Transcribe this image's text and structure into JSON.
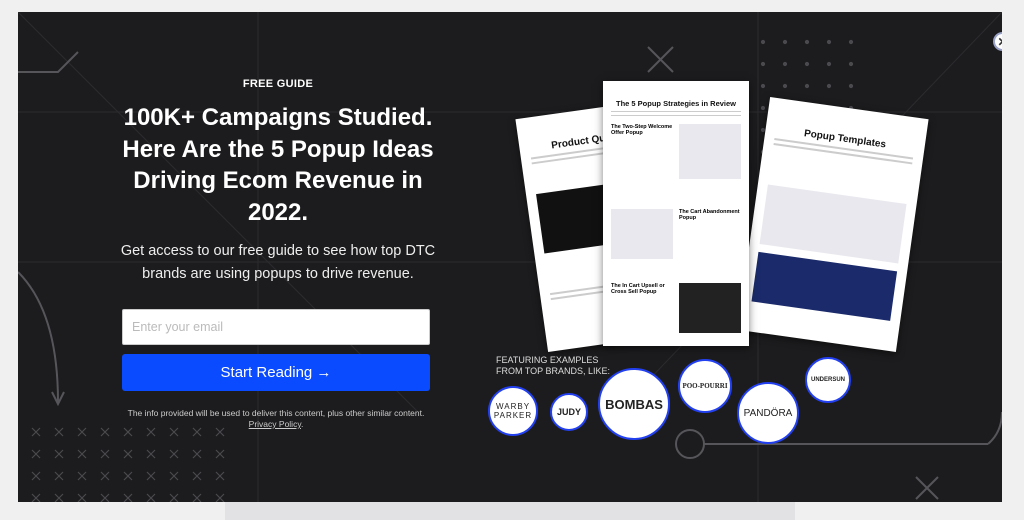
{
  "modal": {
    "eyebrow": "FREE GUIDE",
    "title": "100K+ Campaigns Studied. Here Are the 5 Popup Ideas Driving Ecom Revenue in 2022.",
    "subtitle": "Get access to our free guide to see how top DTC brands are using popups to drive revenue.",
    "email_placeholder": "Enter your email",
    "email_value": "",
    "cta_label": "Start Reading →",
    "disclaimer": "The info provided will be used to deliver this content, plus other similar content.",
    "privacy_link": "Privacy Policy",
    "close_icon": "close-icon"
  },
  "preview": {
    "pages": [
      {
        "title": "Product Quiz Popup"
      },
      {
        "title": "The 5 Popup Strategies in Review",
        "sections": [
          "The Two-Step Welcome Offer Popup",
          "The Cart Abandonment Popup",
          "The In Cart Upsell or Cross Sell Popup"
        ]
      },
      {
        "title": "Popup Templates"
      }
    ]
  },
  "brands": {
    "heading": "FEATURING EXAMPLES FROM TOP BRANDS, LIKE:",
    "logos": [
      "WARBY PARKER",
      "JUDY",
      "BOMBAS",
      "POO-POURRI",
      "PANDÖRA",
      "UNDERSUN"
    ]
  },
  "colors": {
    "accent": "#0a4bff",
    "background": "#1c1c1e"
  }
}
